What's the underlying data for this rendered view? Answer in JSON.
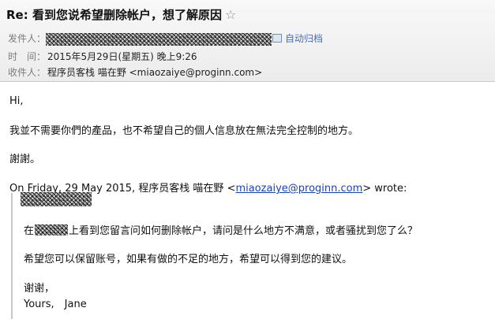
{
  "header": {
    "subject": "Re: 看到您说希望删除帐户，想了解原因",
    "star_icon": "star-icon",
    "from_label": "发件人：",
    "archive_label": "自动归档",
    "time_label": "时　间：",
    "time_value": "2015年5月29日(星期五) 晚上9:26",
    "to_label": "收件人：",
    "to_value": "程序员客栈 喵在野 <miaozaiye@proginn.com>"
  },
  "body": {
    "greeting": "Hi,",
    "line1": "我並不需要你們的產品，也不希望自己的個人信息放在無法完全控制的地方。",
    "thanks": "謝謝。",
    "wrote_prefix": "On Friday, 29 May 2015, 程序员客栈 喵在野 <",
    "wrote_email": "miaozaiye@proginn.com",
    "wrote_suffix": "> wrote:"
  },
  "quote": {
    "q1_prefix": "在",
    "q1_suffix": "上看到您留言问如何删除帐户，请问是什么地方不满意，或者骚扰到您了么？",
    "q2": "希望您可以保留账号，如果有做的不足的地方，希望可以得到您的建议。",
    "q3": "谢谢，",
    "q4": "Yours,　Jane"
  }
}
